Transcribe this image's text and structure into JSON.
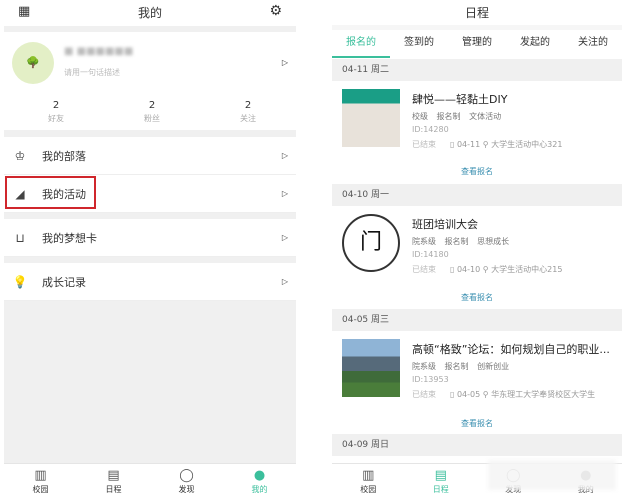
{
  "left": {
    "title": "我的",
    "qr_icon": "qr-code-icon",
    "settings_icon": "gear-icon",
    "profile": {
      "name": "■ ■■■■■■",
      "bio": "请用一句话描述",
      "stats": [
        {
          "value": "2",
          "label": "好友"
        },
        {
          "value": "2",
          "label": "粉丝"
        },
        {
          "value": "2",
          "label": "关注"
        }
      ]
    },
    "menu": [
      {
        "label": "我的部落",
        "icon": "crown-icon"
      },
      {
        "label": "我的活动",
        "icon": "shoe-icon"
      },
      {
        "label": "我的梦想卡",
        "icon": "plant-pot-icon"
      },
      {
        "label": "成长记录",
        "icon": "lightbulb-icon"
      }
    ],
    "highlight_color": "#d0262c"
  },
  "right": {
    "title": "日程",
    "tabs": [
      "报名的",
      "签到的",
      "管理的",
      "发起的",
      "关注的"
    ],
    "groups": [
      {
        "date": "04-11 周二",
        "title": "肆悦——轻黏土DIY",
        "tags": "校级 报名制 文体活动",
        "id": "ID:14280",
        "status": "已结束",
        "day": "04-11",
        "place": "大学生活动中心321",
        "view": "查看报名"
      },
      {
        "date": "04-10 周一",
        "title": "班团培训大会",
        "tags": "院系级 报名制 思想成长",
        "id": "ID:14180",
        "status": "已结束",
        "day": "04-10",
        "place": "大学生活动中心215",
        "view": "查看报名"
      },
      {
        "date": "04-05 周三",
        "title": "高顿“格致”论坛：如何规划自己的职业...",
        "tags": "院系级 报名制 创新创业",
        "id": "ID:13953",
        "status": "已结束",
        "day": "04-05",
        "place": "华东理工大学奉贤校区大学生",
        "view": "查看报名"
      }
    ],
    "last_date": "04-09 周日"
  },
  "tabbar": [
    {
      "label": "校园",
      "icon": "building-icon"
    },
    {
      "label": "日程",
      "icon": "calendar-icon"
    },
    {
      "label": "发现",
      "icon": "planet-icon"
    },
    {
      "label": "我的",
      "icon": "face-icon"
    }
  ],
  "accent": "#3bbf9c"
}
